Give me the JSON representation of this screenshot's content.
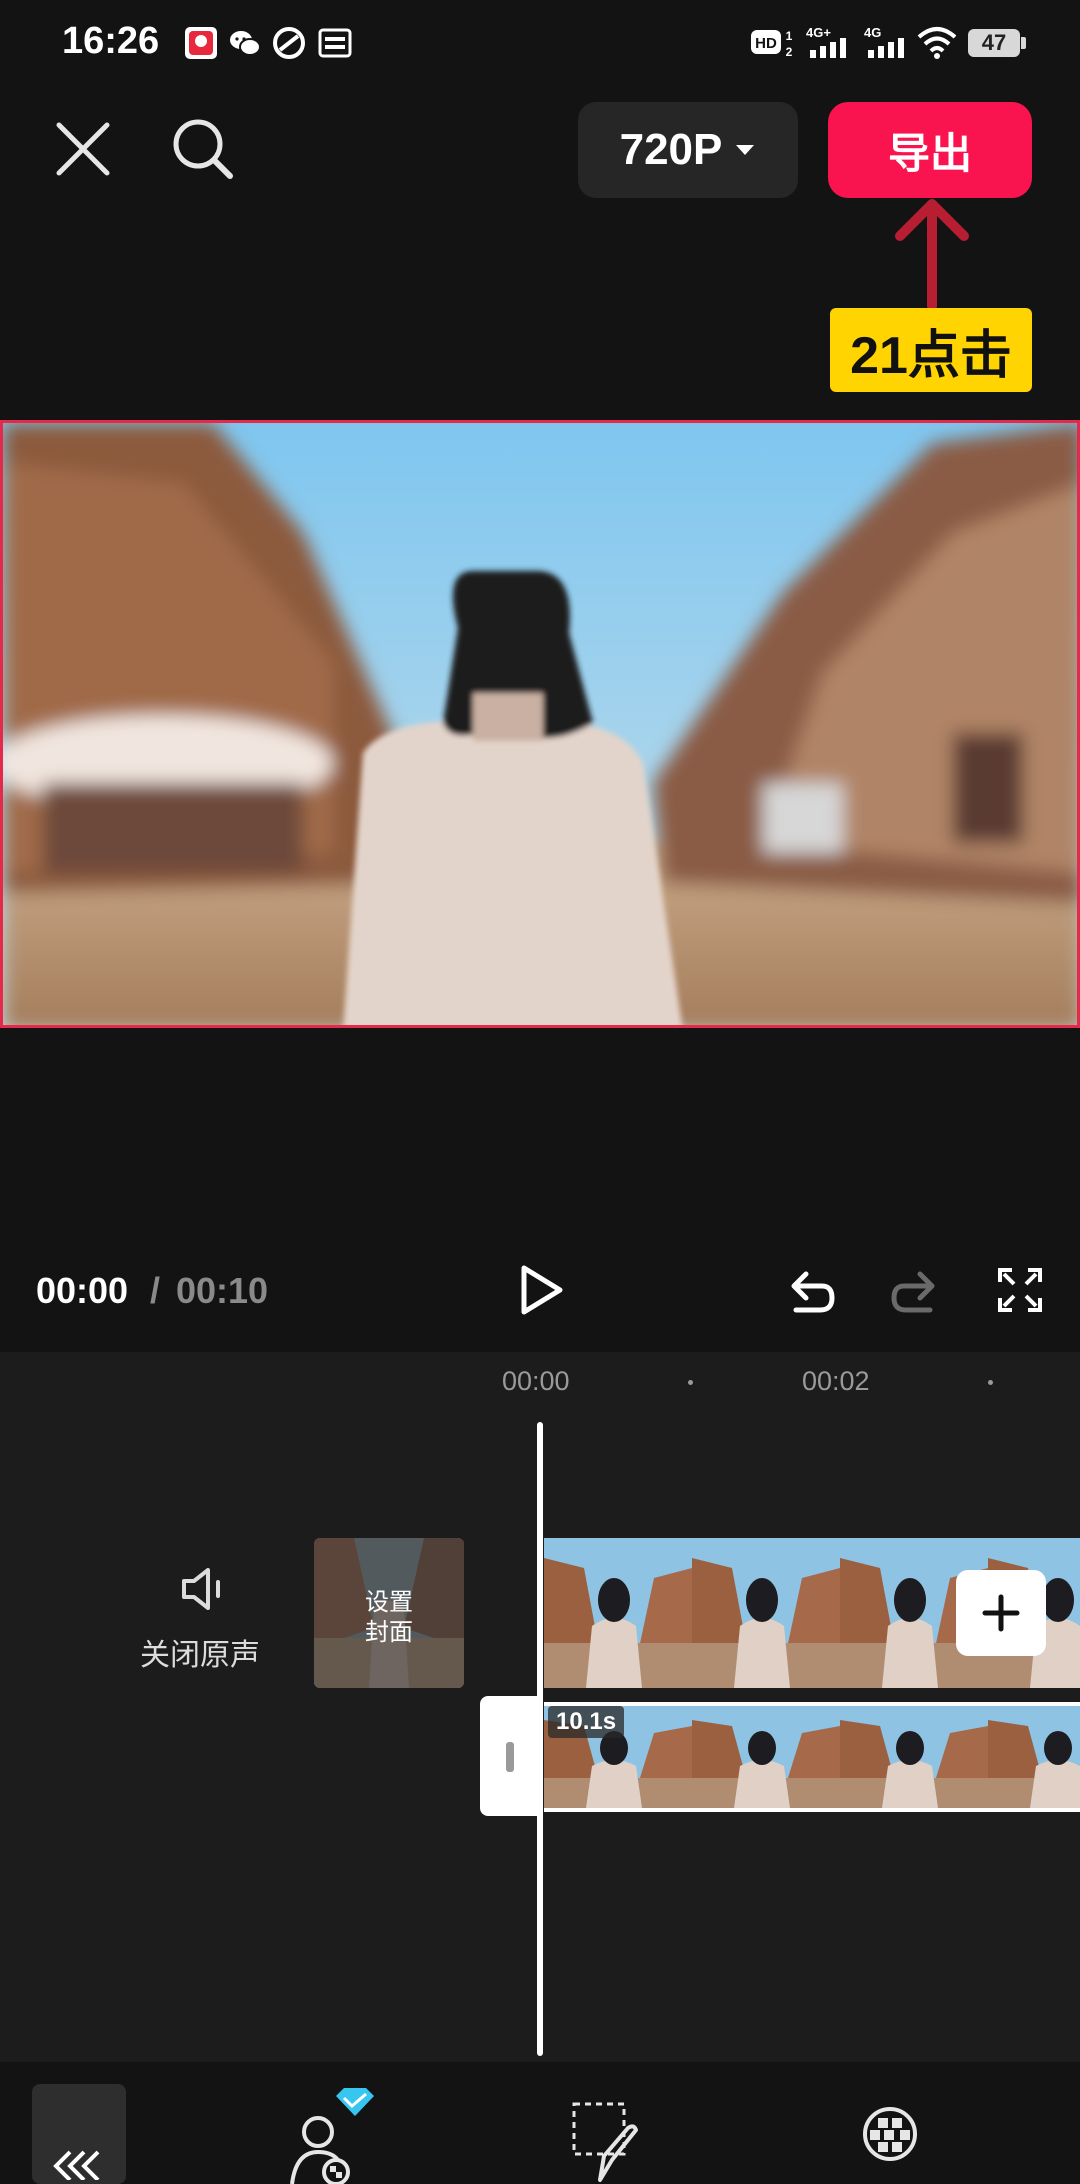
{
  "status_bar": {
    "time": "16:26",
    "notification_icons": [
      "app-notification-icon",
      "wechat-icon",
      "link-app-icon",
      "news-app-icon"
    ],
    "system_icons": [
      "hd-voice-icon",
      "4g-signal-icon",
      "4g-signal-icon",
      "wifi-icon"
    ],
    "battery": "47"
  },
  "top_bar": {
    "close_icon": "close-icon",
    "search_icon": "search-icon",
    "quality_label": "720P",
    "export_label": "导出"
  },
  "annotation": {
    "label": "21点击",
    "color": "#ffd400",
    "arrow_color": "#b81e32"
  },
  "playback": {
    "current_time": "00:00",
    "separator": "/",
    "total_time": "00:10"
  },
  "timeline": {
    "ruler_labels": [
      "00:00",
      "00:02"
    ],
    "mute_label": "关闭原声",
    "cover_label": "设置\n封面",
    "clip_duration": "10.1s"
  },
  "colors": {
    "accent": "#f9144f",
    "background": "#131313",
    "timeline_bg": "#1c1c1c"
  }
}
